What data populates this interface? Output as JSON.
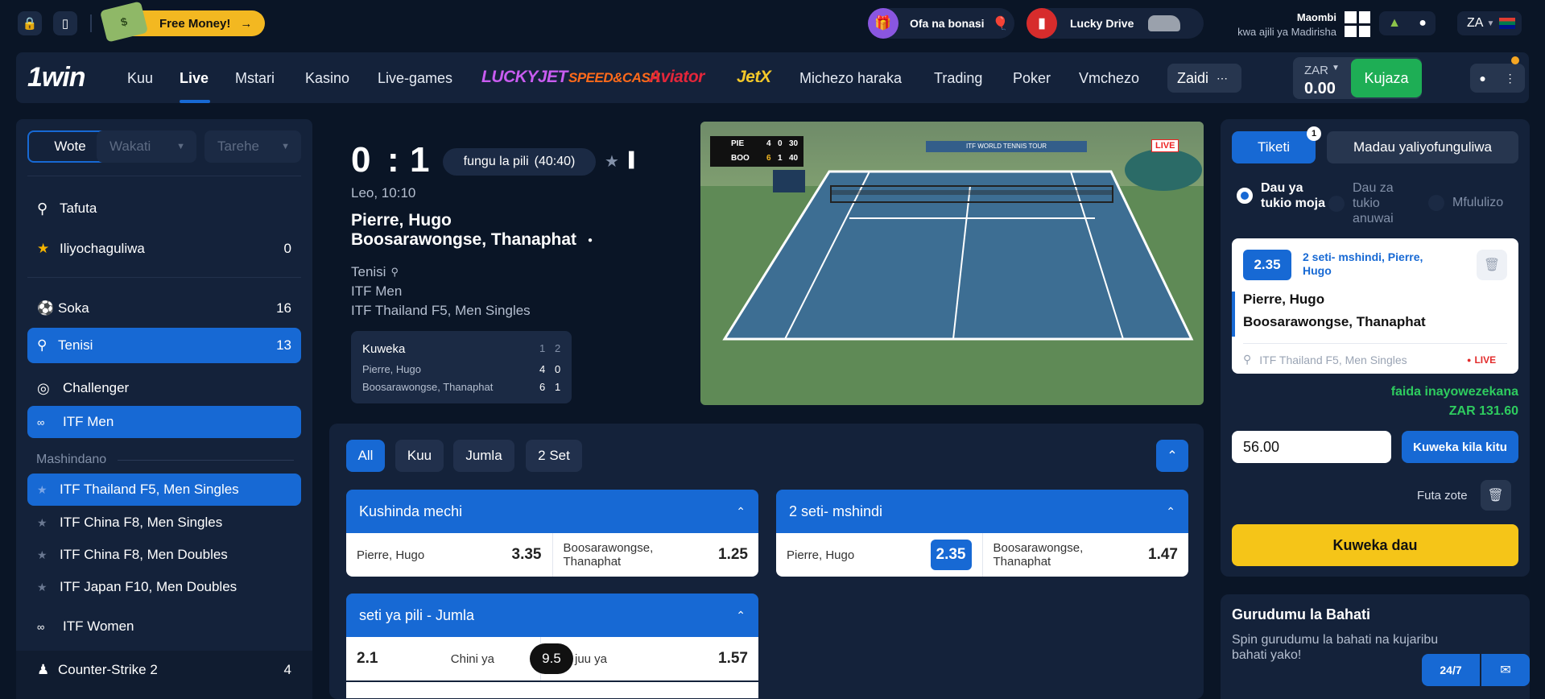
{
  "topbar": {
    "free_money": "Free Money!",
    "promo_bonus": "Ofa na bonasi",
    "promo_lucky": "Lucky Drive",
    "app_title": "Maombi",
    "app_sub": "kwa ajili ya Madirisha",
    "lang": "ZA"
  },
  "nav": {
    "logo": "1win",
    "items": [
      "Kuu",
      "Live",
      "Mstari",
      "Kasino",
      "Live-games",
      "Michezo haraka",
      "Trading",
      "Poker",
      "Vmchezo"
    ],
    "brands": [
      "LUCKYJET",
      "SPEED&CASH",
      "Aviator",
      "JetX"
    ],
    "more": "Zaidi",
    "currency": "ZAR",
    "balance": "0.00",
    "deposit": "Kujaza"
  },
  "sidebar": {
    "filters": [
      "Wote",
      "Wakati",
      "Tarehe"
    ],
    "search": "Tafuta",
    "favorites": {
      "label": "Iliyochaguliwa",
      "count": "0"
    },
    "sports": [
      {
        "label": "Soka",
        "count": "16"
      },
      {
        "label": "Tenisi",
        "count": "13"
      }
    ],
    "challenger": "Challenger",
    "itf_men": "ITF Men",
    "section_label": "Mashindano",
    "tournaments": [
      "ITF Thailand F5, Men Singles",
      "ITF China F8, Men Singles",
      "ITF China F8, Men Doubles",
      "ITF Japan F10, Men Doubles"
    ],
    "itf_women": "ITF Women",
    "cs2": {
      "label": "Counter-Strike 2",
      "count": "4"
    }
  },
  "match": {
    "score_home": "0",
    "score_sep": ":",
    "score_away": "1",
    "period": "fungu la pili",
    "period_time": "(40:40)",
    "when": "Leo, 10:10",
    "player1": "Pierre, Hugo",
    "player2": "Boosarawongse, Thanaphat",
    "sport": "Tenisi",
    "category": "ITF Men",
    "tournament": "ITF Thailand F5, Men Singles",
    "table": {
      "title": "Kuweka",
      "cols": [
        "1",
        "2"
      ],
      "rows": [
        {
          "name": "Pierre, Hugo",
          "s1": "4",
          "s2": "0"
        },
        {
          "name": "Boosarawongse, Thanaphat",
          "s1": "6",
          "s2": "1"
        }
      ]
    },
    "video": {
      "live": "LIVE",
      "p1": "PIE",
      "p1s": [
        "4",
        "0",
        "30"
      ],
      "p2": "BOO",
      "p2s": [
        "6",
        "1",
        "40"
      ],
      "banner": "ITF WORLD TENNIS TOUR"
    }
  },
  "markets": {
    "tabs": [
      "All",
      "Kuu",
      "Jumla",
      "2 Set"
    ],
    "m1": {
      "title": "Kushinda mechi",
      "a": "Pierre, Hugo",
      "a_odd": "3.35",
      "b": "Boosarawongse, Thanaphat",
      "b_odd": "1.25"
    },
    "m2": {
      "title": "2 seti- mshindi",
      "a": "Pierre, Hugo",
      "a_odd": "2.35",
      "b": "Boosarawongse, Thanaphat",
      "b_odd": "1.47"
    },
    "m3": {
      "title": "seti ya pili - Jumla",
      "under_odd": "2.1",
      "under": "Chini ya",
      "line": "9.5",
      "over": "juu ya",
      "over_odd": "1.57"
    }
  },
  "slip": {
    "tab1": "Tiketi",
    "tab1_badge": "1",
    "tab2": "Madau yaliyofunguliwa",
    "modes": [
      "Dau ya tukio moja",
      "Dau za tukio anuwai",
      "Mfululizo"
    ],
    "bet_odd": "2.35",
    "bet_market": "2 seti- mshindi, Pierre, Hugo",
    "bet_p1": "Pierre, Hugo",
    "bet_p2": "Boosarawongse, Thanaphat",
    "bet_tournament": "ITF Thailand F5, Men Singles",
    "bet_live": "LIVE",
    "profit_label": "faida inayowezekana",
    "profit_value": "ZAR 131.60",
    "stake": "56.00",
    "all_in": "Kuweka kila kitu",
    "clear_all": "Futa zote",
    "place": "Kuweka dau"
  },
  "wheel": {
    "title": "Gurudumu la Bahati",
    "text": "Spin gurudumu la bahati na kujaribu bahati yako!",
    "support": "24/7"
  }
}
